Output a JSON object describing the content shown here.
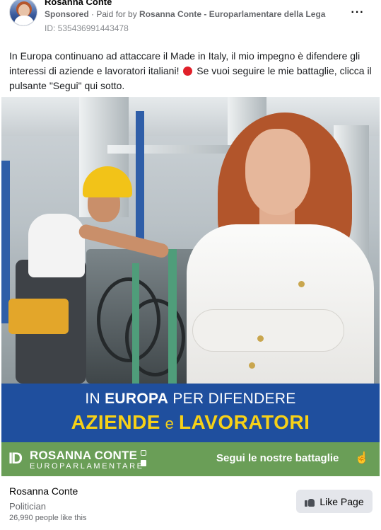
{
  "header": {
    "page_name": "Rosanna Conte",
    "sponsored_label": "Sponsored",
    "paid_for_label": " · Paid for by ",
    "payer": "Rosanna Conte - Europarlamentare della Lega",
    "ad_id": "ID: 535436991443478",
    "more_icon": "more-options-icon",
    "more_glyph": "···"
  },
  "post": {
    "text_before_icon": "In Europa continuano ad attaccare il Made in Italy, il mio impegno è difendere gli interessi di aziende e lavoratori italiani!",
    "icon": "red-circle-emoji",
    "text_after_icon": "Se vuoi seguire le mie battaglie, clicca il pulsante \"Segui\" qui sotto."
  },
  "creative": {
    "headline_part1": "IN ",
    "headline_bold1": "EUROPA",
    "headline_part2": " PER DIFENDERE",
    "headline_line2_a": "AZIENDE",
    "headline_line2_e": " e ",
    "headline_line2_b": "LAVORATORI",
    "brand_mark": "ID",
    "brand_name": "ROSANNA CONTE",
    "brand_sub": "EUROPARLAMENTARE",
    "cta": "Segui le nostre battaglie",
    "cta_icon": "pointing-hand-icon",
    "colors": {
      "blue": "#1f4f9e",
      "yellow": "#f7d117",
      "green": "#6a9e57"
    }
  },
  "footer": {
    "page_name": "Rosanna Conte",
    "category": "Politician",
    "likes": "26,990 people like this",
    "like_button_label": "Like Page",
    "like_icon": "thumbs-up-icon"
  }
}
